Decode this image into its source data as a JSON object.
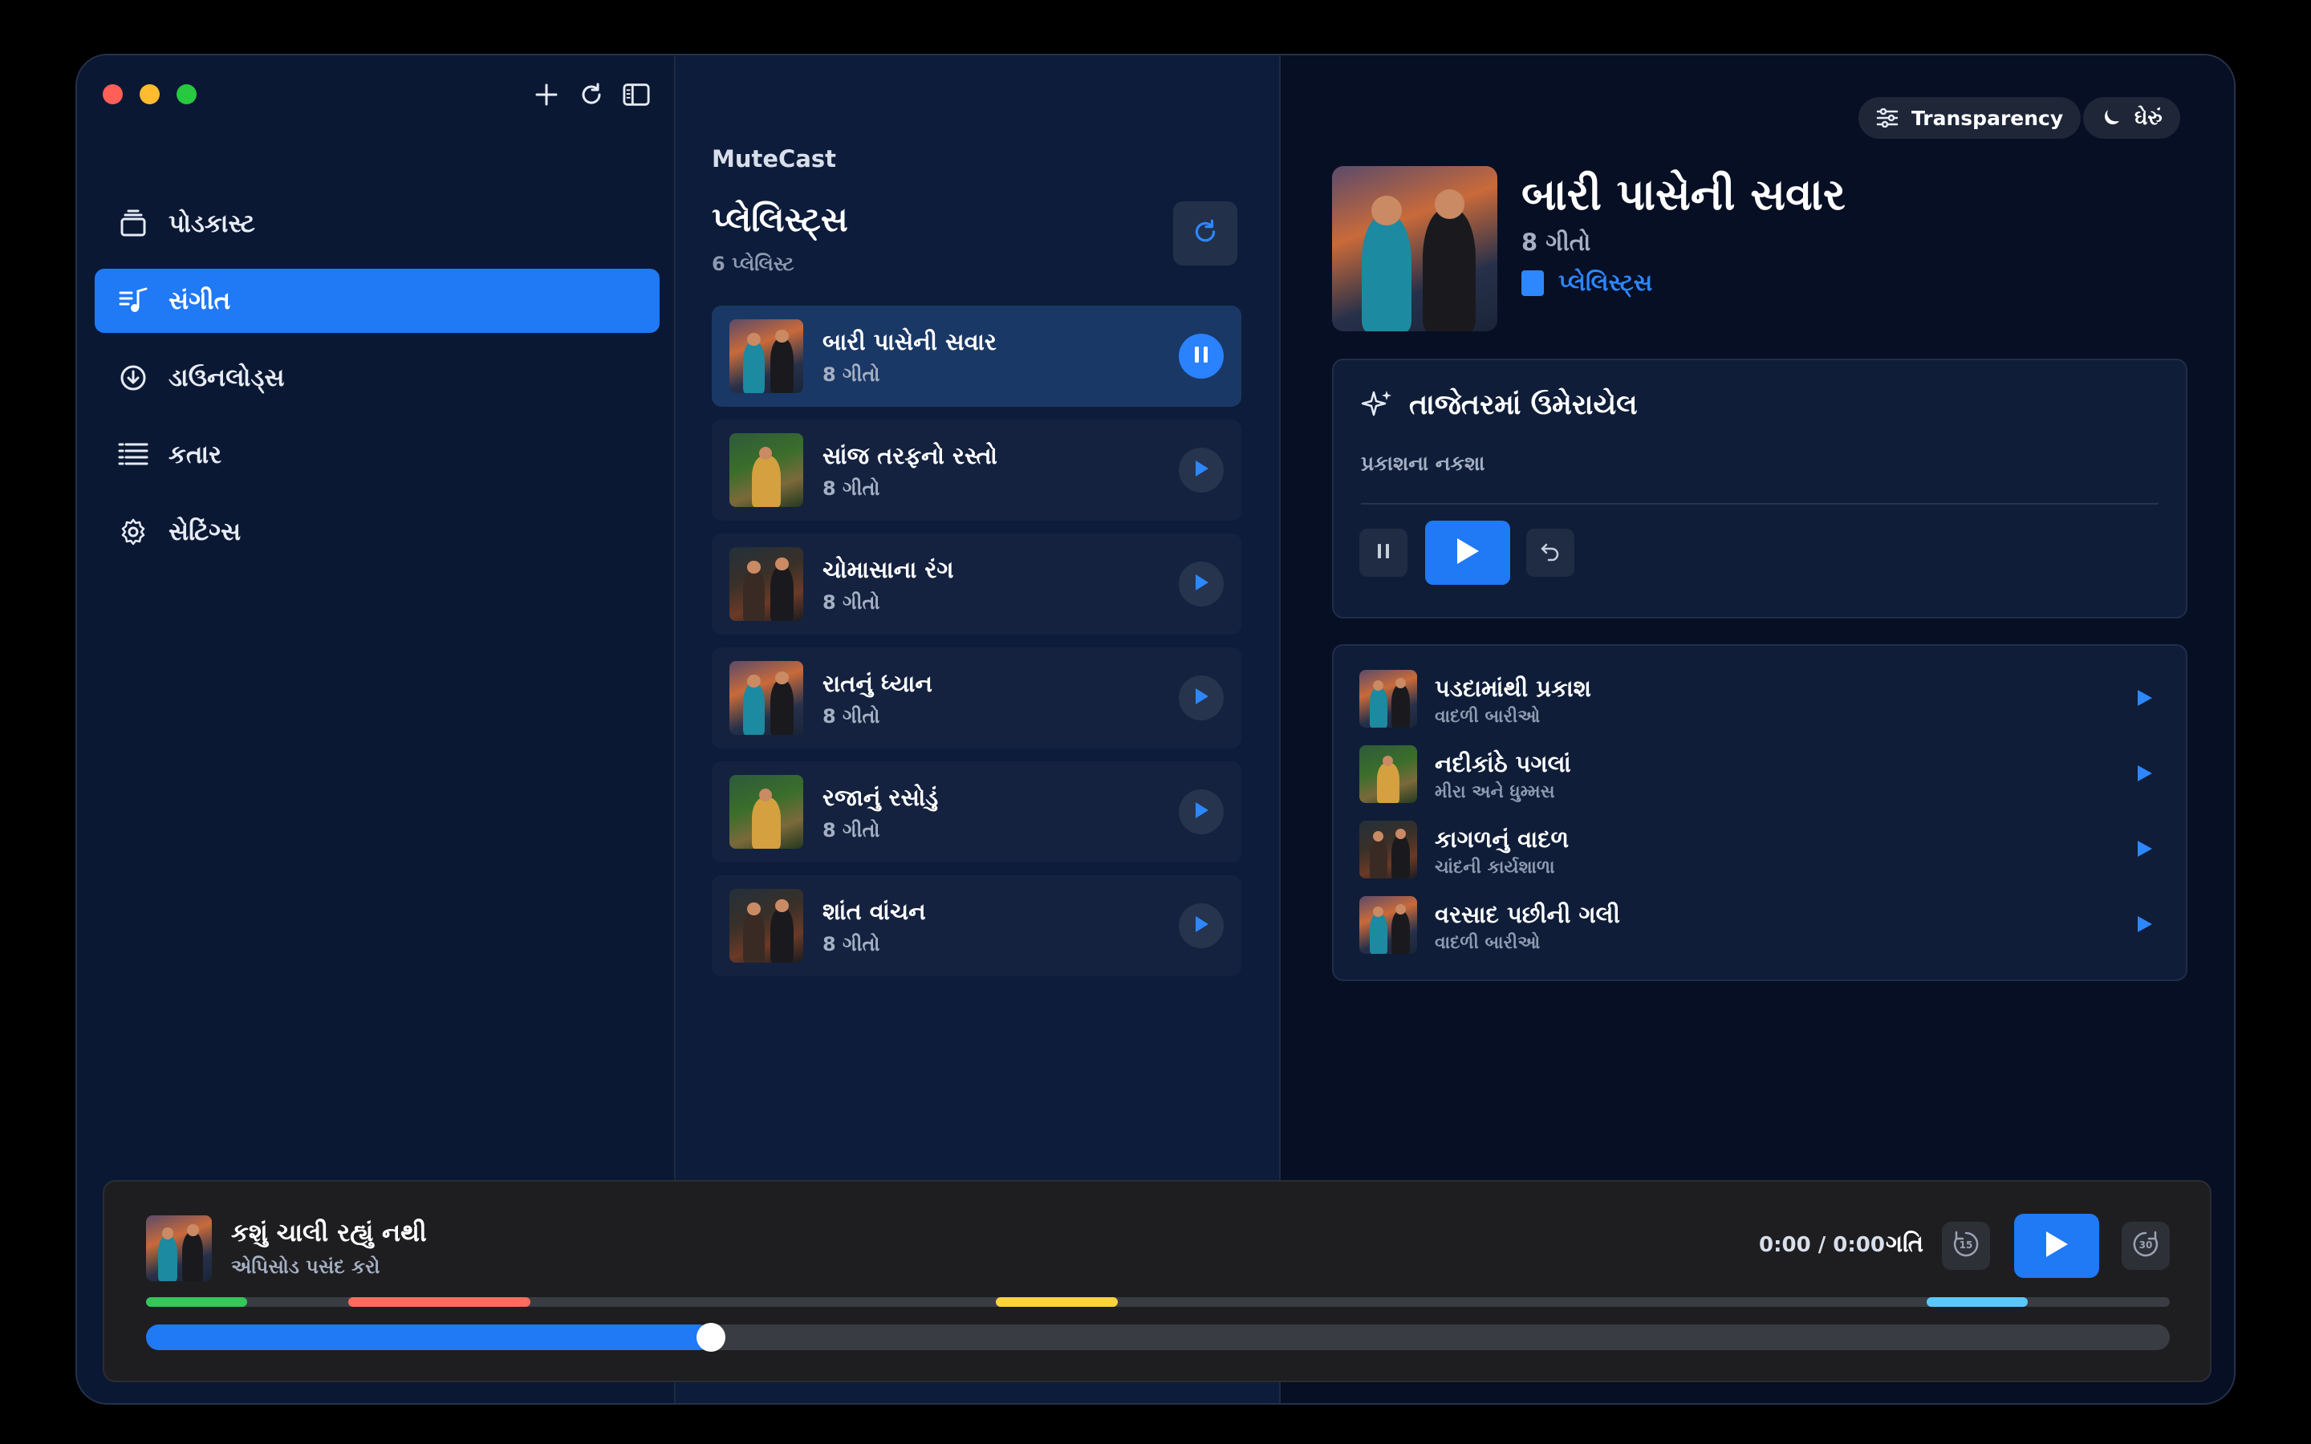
{
  "sidebar": {
    "items": [
      {
        "label": "પોડકાસ્ટ",
        "icon": "podcast-icon"
      },
      {
        "label": "સંગીત",
        "icon": "music-icon"
      },
      {
        "label": "ડાઉનલોડ્સ",
        "icon": "download-icon"
      },
      {
        "label": "કતાર",
        "icon": "queue-icon"
      },
      {
        "label": "સેટિંગ્સ",
        "icon": "gear-icon"
      }
    ],
    "active_index": 1
  },
  "middle": {
    "brand": "MuteCast",
    "title": "પ્લેલિસ્ટ્સ",
    "subtitle": "6 પ્લેલિસ્ટ",
    "playlists": [
      {
        "name": "બારી પાસેની સવાર",
        "count": "8 ગીતો",
        "art": "a",
        "active": true
      },
      {
        "name": "સાંજ તરફનો રસ્તો",
        "count": "8 ગીતો",
        "art": "b",
        "active": false
      },
      {
        "name": "ચોમાસાના રંગ",
        "count": "8 ગીતો",
        "art": "c",
        "active": false
      },
      {
        "name": "રાતનું ધ્યાન",
        "count": "8 ગીતો",
        "art": "a",
        "active": false
      },
      {
        "name": "રજાનું રસોડું",
        "count": "8 ગીતો",
        "art": "b",
        "active": false
      },
      {
        "name": "શાંત વાંચન",
        "count": "8 ગીતો",
        "art": "c",
        "active": false
      }
    ]
  },
  "header": {
    "transparency_label": "Transparency",
    "theme_label": "ઘેરું"
  },
  "album": {
    "title": "બારી પાસેની સવાર",
    "count": "8 ગીતો",
    "link": "પ્લેલિસ્ટ્સ"
  },
  "recent": {
    "title": "તાજેતરમાં ઉમેરાયેલ",
    "subtitle": "પ્રકાશના નકશા"
  },
  "tracks": [
    {
      "name": "પડદામાંથી પ્રકાશ",
      "artist": "વાદળી બારીઓ",
      "art": "a"
    },
    {
      "name": "નદીકાંઠે પગલાં",
      "artist": "મીરા અને ધુમ્મસ",
      "art": "b"
    },
    {
      "name": "કાગળનું વાદળ",
      "artist": "ચાંદની કાર્યશાળા",
      "art": "c"
    },
    {
      "name": "વરસાદ પછીની ગલી",
      "artist": "વાદળી બારીઓ",
      "art": "a"
    }
  ],
  "player": {
    "title": "કશું ચાલી રહ્યું નથી",
    "subtitle": "એપિસોડ પસંદ કરો",
    "time": "0:00 / 0:00",
    "speed_label": "ગતિ",
    "skip_back": "15",
    "skip_forward": "30",
    "progress_fraction": 0.279,
    "chapters": [
      {
        "start": 0.0,
        "end": 0.05,
        "color": "#34c759"
      },
      {
        "start": 0.1,
        "end": 0.19,
        "color": "#ff6b5c"
      },
      {
        "start": 0.42,
        "end": 0.48,
        "color": "#ffd43b"
      },
      {
        "start": 0.88,
        "end": 0.93,
        "color": "#5ac8fa"
      }
    ]
  },
  "colors": {
    "accent": "#2079f5",
    "traffic_red": "#ff5f57",
    "traffic_yellow": "#febc2e",
    "traffic_green": "#28c840"
  }
}
